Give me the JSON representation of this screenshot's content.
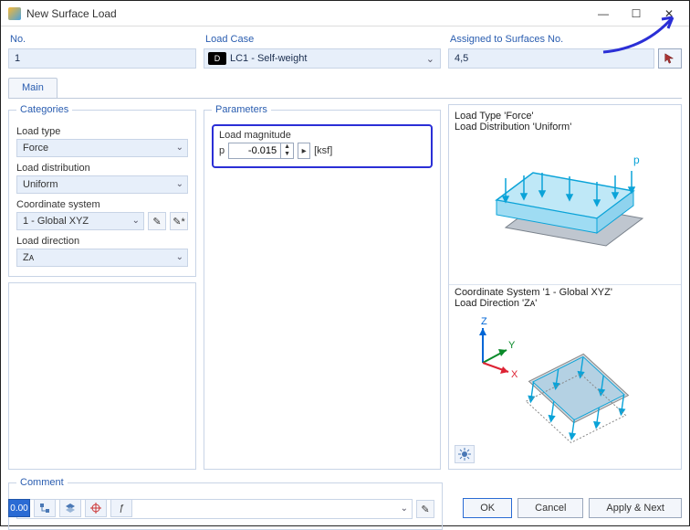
{
  "window": {
    "title": "New Surface Load"
  },
  "top": {
    "no_label": "No.",
    "no_value": "1",
    "loadcase_label": "Load Case",
    "loadcase_tag": "D",
    "loadcase_value": "LC1 - Self-weight",
    "assigned_label": "Assigned to Surfaces No.",
    "assigned_value": "4,5"
  },
  "tabs": {
    "main": "Main"
  },
  "categories": {
    "legend": "Categories",
    "loadtype_label": "Load type",
    "loadtype_value": "Force",
    "loaddist_label": "Load distribution",
    "loaddist_value": "Uniform",
    "coord_label": "Coordinate system",
    "coord_value": "1 - Global XYZ",
    "dir_label": "Load direction",
    "dir_value": "Zᴀ"
  },
  "parameters": {
    "legend": "Parameters",
    "magnitude_label": "Load magnitude",
    "symbol": "p",
    "value": "-0.015",
    "unit": "[ksf]"
  },
  "right": {
    "line1a": "Load Type 'Force'",
    "line1b": "Load Distribution 'Uniform'",
    "p_label": "p",
    "line2a": "Coordinate System '1 - Global XYZ'",
    "line2b": "Load Direction 'Zᴀ'",
    "axis_z": "Z",
    "axis_y": "Y",
    "axis_x": "X"
  },
  "comment": {
    "legend": "Comment"
  },
  "footer": {
    "ok": "OK",
    "cancel": "Cancel",
    "applynext": "Apply & Next",
    "tool1": "0.00"
  }
}
